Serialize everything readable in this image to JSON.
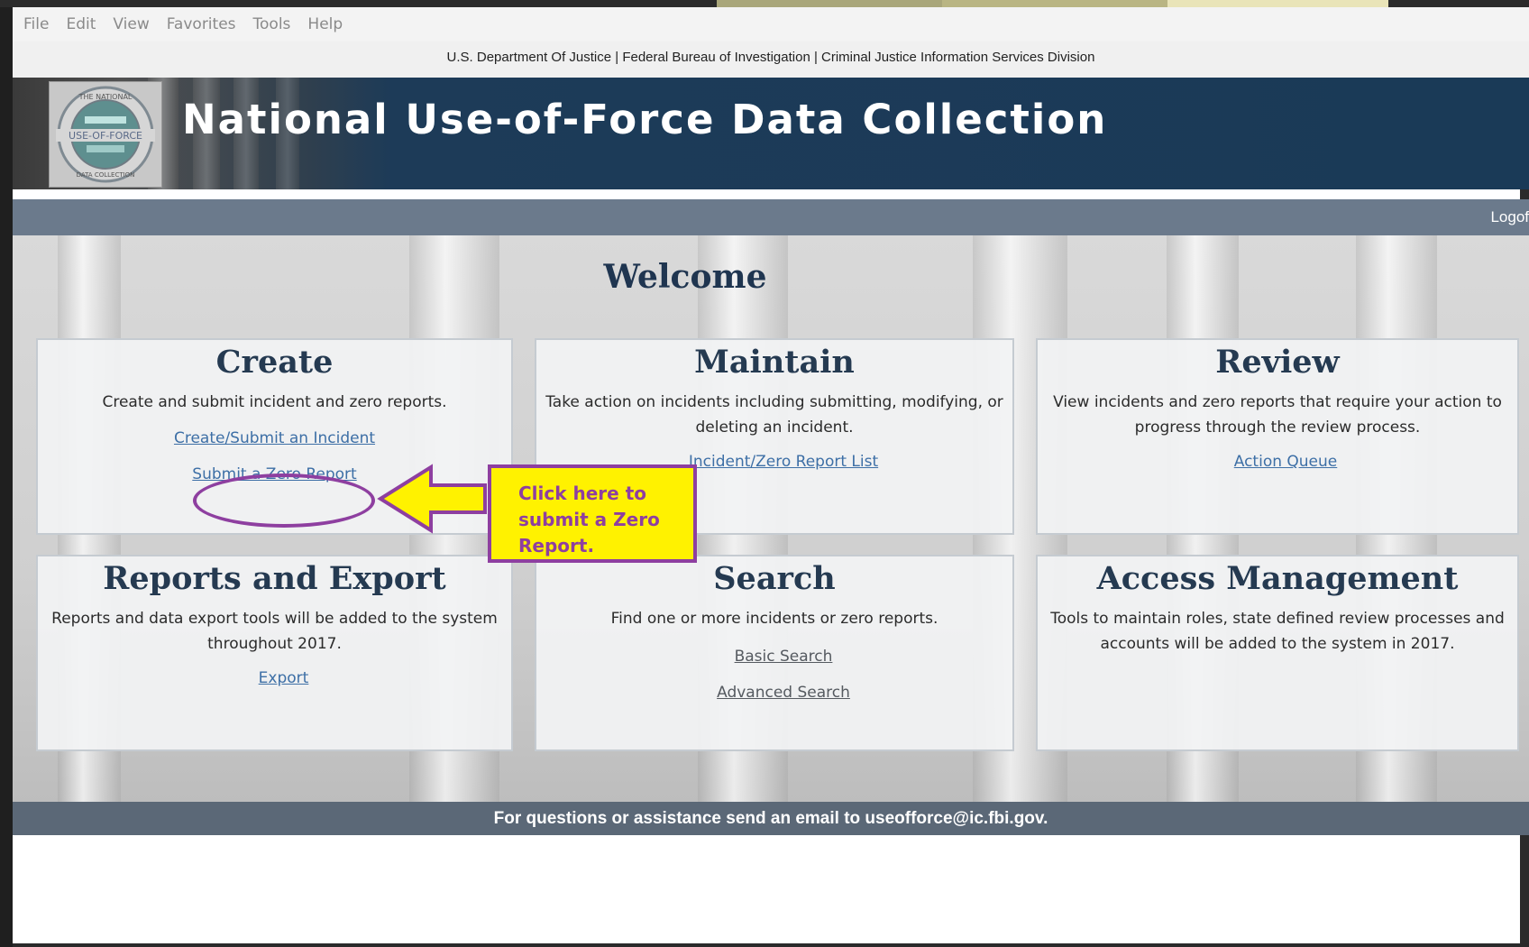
{
  "menu": [
    "File",
    "Edit",
    "View",
    "Favorites",
    "Tools",
    "Help"
  ],
  "agency_line": "U.S. Department Of Justice | Federal Bureau of Investigation | Criminal Justice Information Services Division",
  "banner": {
    "title": "National Use-of-Force Data Collection",
    "logo_text": {
      "top": "THE NATIONAL",
      "middle": "USE-OF-FORCE",
      "bottom": "DATA COLLECTION"
    }
  },
  "nav": {
    "logoff_label": "Logof"
  },
  "welcome": "Welcome",
  "panels": {
    "create": {
      "title": "Create",
      "description": "Create and submit incident and zero reports.",
      "link1": "Create/Submit an Incident",
      "link2": "Submit a Zero Report"
    },
    "maintain": {
      "title": "Maintain",
      "description_line1": "Take action on incidents including submitting, modifying, or",
      "description_line2": "deleting an incident.",
      "link1": "Incident/Zero Report List"
    },
    "review": {
      "title": "Review",
      "description_line1": "View incidents and zero reports that require your action to",
      "description_line2": "progress through the review process.",
      "link1": "Action Queue"
    },
    "reports": {
      "title": "Reports and Export",
      "description_line1": "Reports and data export tools will be added to the system",
      "description_line2": "throughout 2017.",
      "link1": "Export"
    },
    "search": {
      "title": "Search",
      "description": "Find one or more incidents or zero reports.",
      "link1": "Basic Search",
      "link2": "Advanced Search"
    },
    "access": {
      "title": "Access Management",
      "description_line1": "Tools to maintain roles, state defined review processes and",
      "description_line2": "accounts will be added to the system in 2017."
    }
  },
  "callout": {
    "line1": "Click here to",
    "line2": "submit a Zero",
    "line3": "Report."
  },
  "footer": "For questions or assistance send an email to useofforce@ic.fbi.gov.",
  "colors": {
    "banner": "#1a3a57",
    "nav": "#6b7a8c",
    "footer": "#5b6877",
    "heading": "#253a51",
    "link": "#3d6fa6",
    "callout_fill": "#fff200",
    "callout_border": "#8e3fa0"
  }
}
